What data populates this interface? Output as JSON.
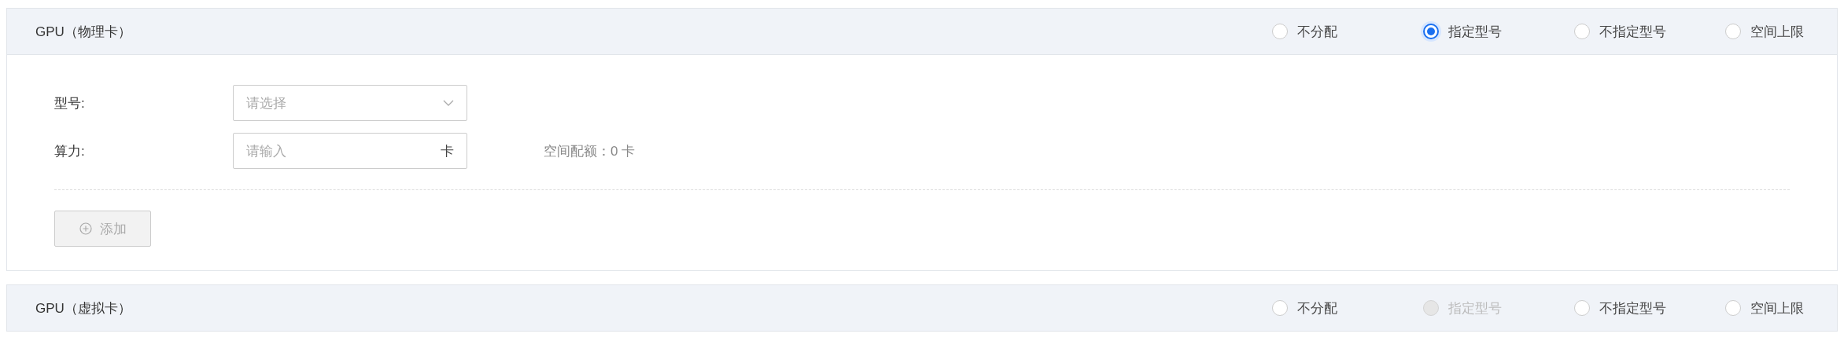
{
  "panels": [
    {
      "title": "GPU（物理卡）",
      "expanded": true,
      "options": [
        {
          "label": "不分配",
          "selected": false,
          "disabled": false
        },
        {
          "label": "指定型号",
          "selected": true,
          "disabled": false
        },
        {
          "label": "不指定型号",
          "selected": false,
          "disabled": false
        },
        {
          "label": "空间上限",
          "selected": false,
          "disabled": false
        }
      ],
      "form": {
        "model_label": "型号:",
        "model_placeholder": "请选择",
        "power_label": "算力:",
        "power_placeholder": "请输入",
        "power_unit": "卡",
        "quota": "空间配额：0 卡",
        "add_button": "添加",
        "add_disabled": true
      }
    },
    {
      "title": "GPU（虚拟卡）",
      "expanded": false,
      "options": [
        {
          "label": "不分配",
          "selected": false,
          "disabled": false
        },
        {
          "label": "指定型号",
          "selected": false,
          "disabled": true
        },
        {
          "label": "不指定型号",
          "selected": false,
          "disabled": false
        },
        {
          "label": "空间上限",
          "selected": false,
          "disabled": false
        }
      ]
    }
  ]
}
